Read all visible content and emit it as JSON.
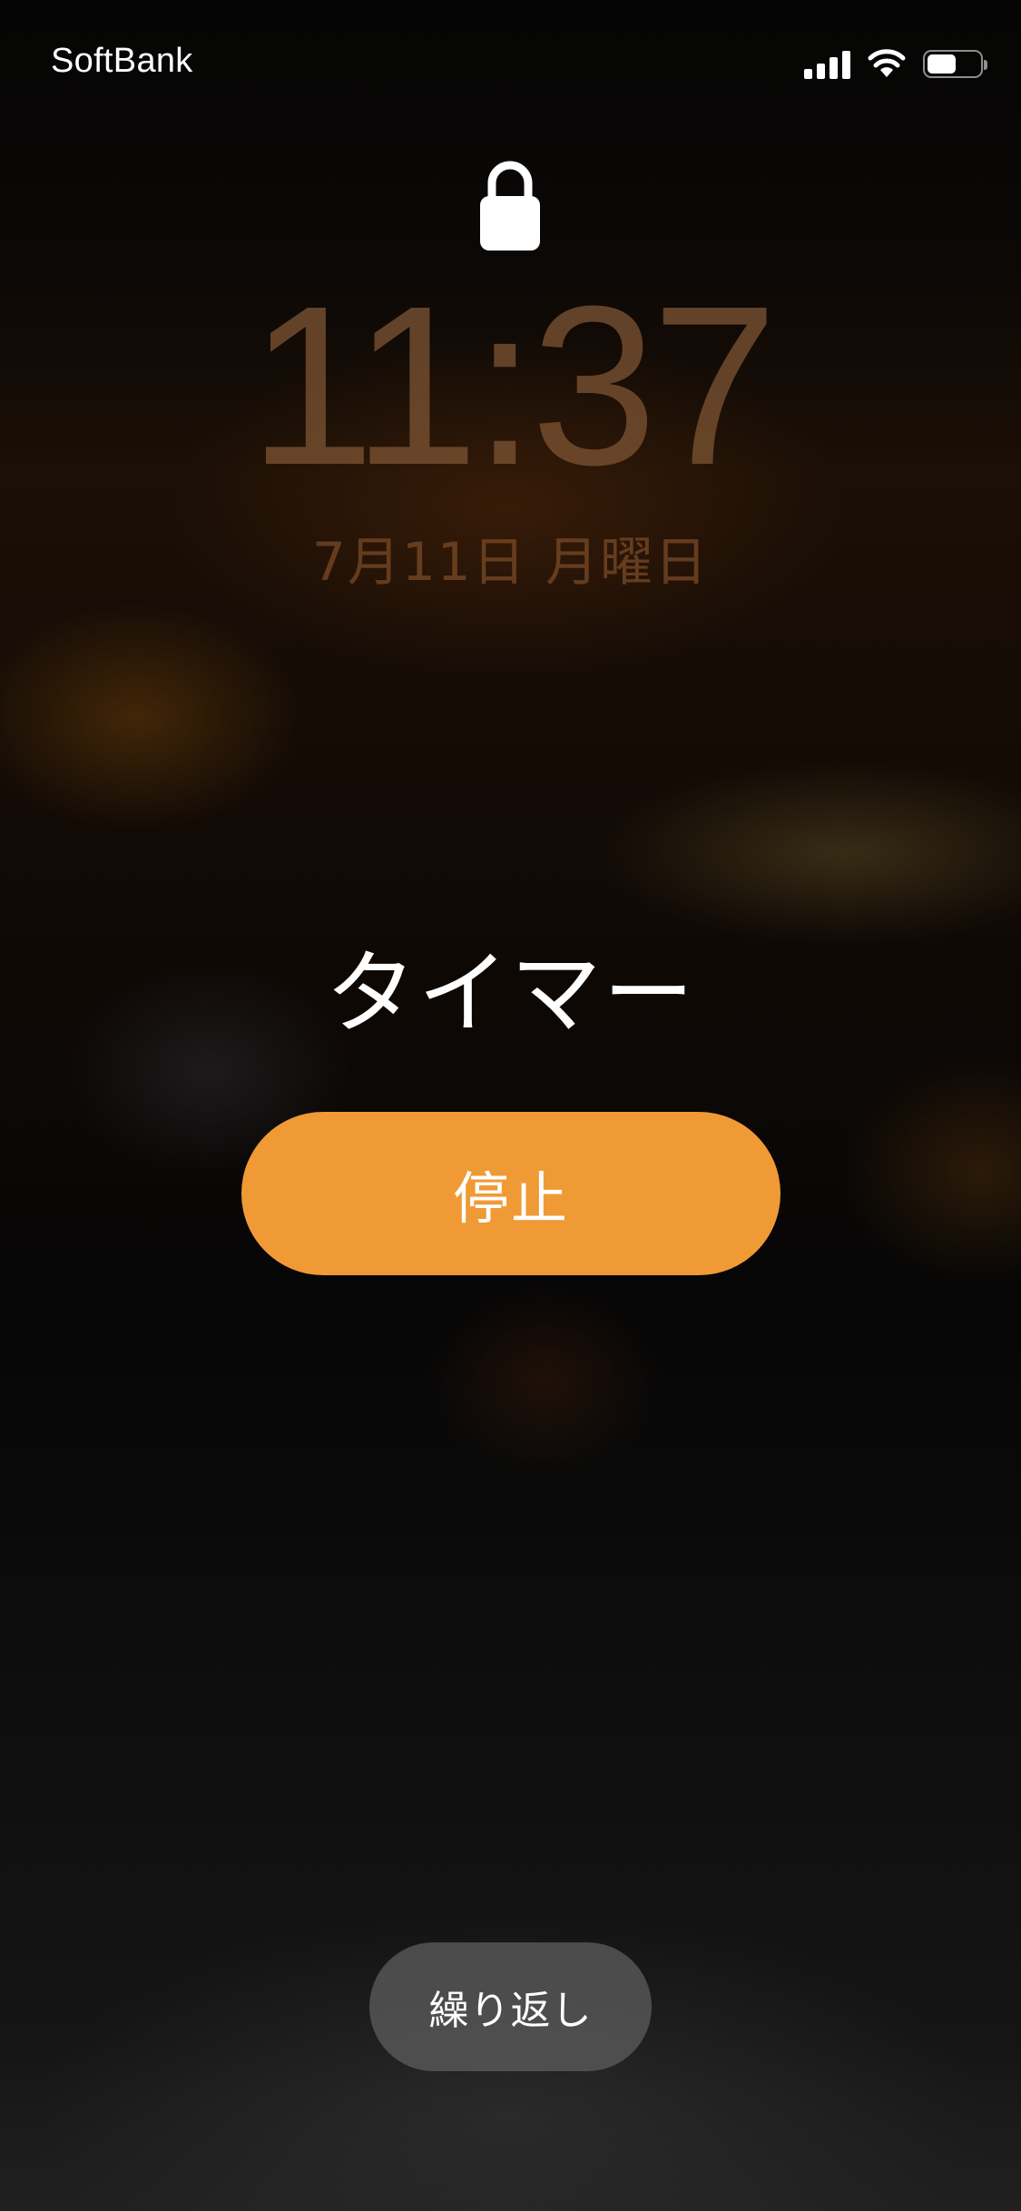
{
  "status_bar": {
    "carrier": "SoftBank",
    "icons": [
      "cellular-signal-icon",
      "wifi-icon",
      "battery-icon"
    ],
    "battery_level": 0.55
  },
  "lock_screen": {
    "lock_icon": "lock-icon",
    "time": "11:37",
    "date": "7月11日 月曜日"
  },
  "alert": {
    "title": "タイマー",
    "stop_label": "停止",
    "repeat_label": "繰り返し"
  },
  "colors": {
    "stop_button": "#f09a36",
    "repeat_button": "#5f5f5f",
    "text": "#ffffff"
  }
}
